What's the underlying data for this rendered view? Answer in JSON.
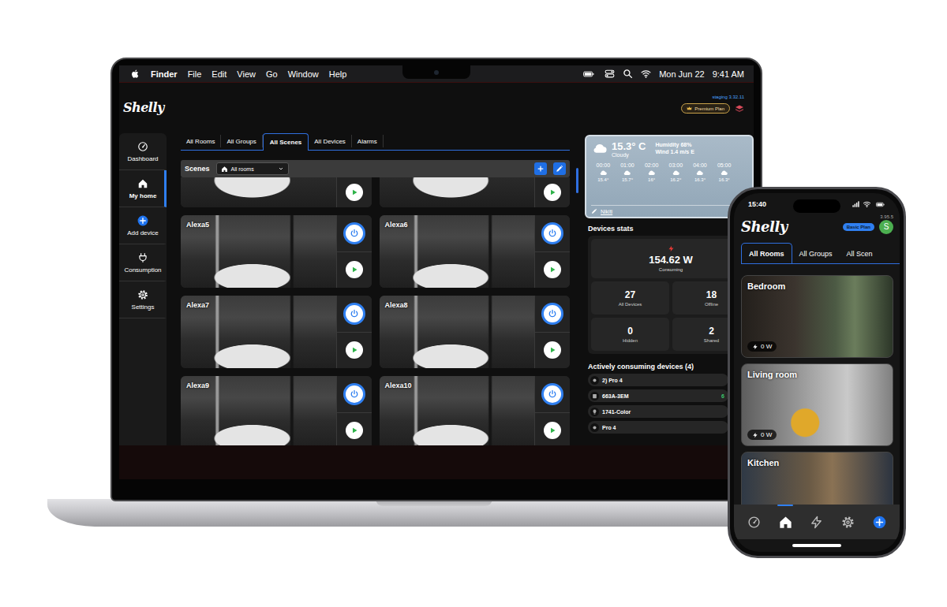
{
  "menubar": {
    "app": "Finder",
    "menus": [
      "File",
      "Edit",
      "View",
      "Go",
      "Window",
      "Help"
    ],
    "date": "Mon Jun 22",
    "time": "9:41 AM"
  },
  "app": {
    "logo": "Shelly",
    "build": "staging 3.32.11",
    "plan": "Premium Plan"
  },
  "sidebar": [
    {
      "label": "Dashboard",
      "kind": "dashboard",
      "selected": false
    },
    {
      "label": "My home",
      "kind": "home",
      "selected": true
    },
    {
      "label": "Add device",
      "kind": "add",
      "selected": false
    },
    {
      "label": "Consumption",
      "kind": "consumption",
      "selected": false
    },
    {
      "label": "Settings",
      "kind": "settings",
      "selected": false
    }
  ],
  "tabs": [
    {
      "label": "All Rooms",
      "selected": false
    },
    {
      "label": "All Groups",
      "selected": false
    },
    {
      "label": "All Scenes",
      "selected": true
    },
    {
      "label": "All Devices",
      "selected": false
    },
    {
      "label": "Alarms",
      "selected": false
    }
  ],
  "scenes_bar": {
    "title": "Scenes",
    "filter": "All rooms"
  },
  "scenes": [
    {
      "kind": "cut"
    },
    {
      "kind": "cut"
    },
    {
      "kind": "full",
      "name": "Alexa5"
    },
    {
      "kind": "full",
      "name": "Alexa6"
    },
    {
      "kind": "full",
      "name": "Alexa7"
    },
    {
      "kind": "full",
      "name": "Alexa8"
    },
    {
      "kind": "full",
      "name": "Alexa9"
    },
    {
      "kind": "full",
      "name": "Alexa10"
    }
  ],
  "weather": {
    "temp": "15.3° C",
    "condition": "Cloudy",
    "humidity": "Humidity 68%",
    "wind": "Wind 1.4 m/s E",
    "hours": [
      {
        "time": "00:00",
        "temp": "15.4°"
      },
      {
        "time": "01:00",
        "temp": "15.7°"
      },
      {
        "time": "02:00",
        "temp": "16°"
      },
      {
        "time": "03:00",
        "temp": "16.2°"
      },
      {
        "time": "04:00",
        "temp": "16.3°"
      },
      {
        "time": "05:00",
        "temp": "16.3°"
      }
    ],
    "location": "Nikiti"
  },
  "stats": {
    "title": "Devices stats",
    "power": "154.62 W",
    "power_label": "Consuming",
    "counts": [
      {
        "value": "27",
        "label": "All Devices"
      },
      {
        "value": "18",
        "label": "Offline"
      },
      {
        "value": "0",
        "label": "Hidden"
      },
      {
        "value": "2",
        "label": "Shared"
      }
    ]
  },
  "consuming": {
    "title": "Actively consuming devices (4)",
    "devices": [
      {
        "name": "2) Pro 4",
        "kind": "switch"
      },
      {
        "name": "663A-3EM",
        "kind": "meter",
        "reading": "6"
      },
      {
        "name": "1741-Color",
        "kind": "bulb"
      },
      {
        "name": "Pro 4",
        "kind": "switch"
      }
    ]
  },
  "phone": {
    "time": "15:40",
    "version": "3.95.5",
    "plan": "Basic Plan",
    "avatar": "S",
    "logo": "Shelly",
    "tabs": [
      {
        "label": "All Rooms",
        "selected": true
      },
      {
        "label": "All Groups",
        "selected": false
      },
      {
        "label": "All Scen",
        "selected": false
      }
    ],
    "rooms": [
      {
        "name": "Bedroom",
        "power": "0 W"
      },
      {
        "name": "Living room",
        "power": "0 W"
      },
      {
        "name": "Kitchen"
      }
    ],
    "nav": [
      {
        "kind": "dashboard",
        "selected": false
      },
      {
        "kind": "home",
        "selected": true
      },
      {
        "kind": "consumption",
        "selected": false
      },
      {
        "kind": "settings",
        "selected": false
      },
      {
        "kind": "add",
        "selected": false
      }
    ]
  }
}
